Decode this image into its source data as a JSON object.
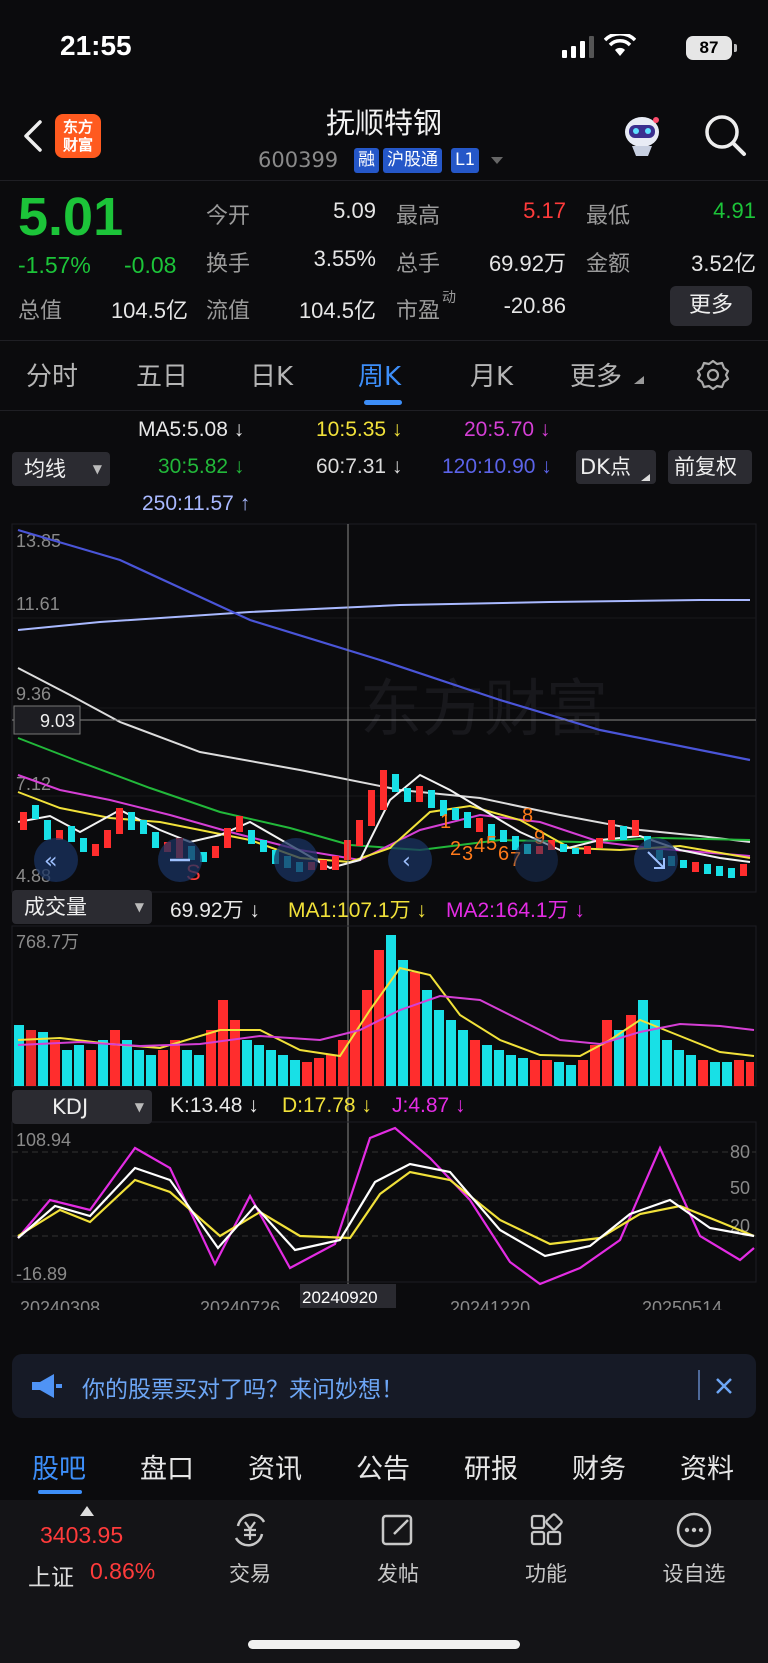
{
  "status": {
    "time": "21:55",
    "battery": "87"
  },
  "header": {
    "logo_text_1": "东方",
    "logo_text_2": "财富",
    "stock_name": "抚顺特钢",
    "stock_code": "600399",
    "tags": [
      "融",
      "沪股通",
      "L1"
    ]
  },
  "quote": {
    "price": "5.01",
    "change_pct": "-1.57%",
    "change_abs": "-0.08",
    "fields": [
      {
        "label": "今开",
        "value": "5.09",
        "color": "#e6e6e6"
      },
      {
        "label": "最高",
        "value": "5.17",
        "color": "#ff3b3b"
      },
      {
        "label": "最低",
        "value": "4.91",
        "color": "#1cc439"
      },
      {
        "label": "换手",
        "value": "3.55%",
        "color": "#e6e6e6"
      },
      {
        "label": "总手",
        "value": "69.92万",
        "color": "#e6e6e6"
      },
      {
        "label": "金额",
        "value": "3.52亿",
        "color": "#e6e6e6"
      },
      {
        "label": "总值",
        "value": "104.5亿",
        "color": "#e6e6e6"
      },
      {
        "label": "流值",
        "value": "104.5亿",
        "color": "#e6e6e6"
      },
      {
        "label": "市盈",
        "label_sup": "动",
        "value": "-20.86",
        "color": "#e6e6e6"
      }
    ],
    "more_label": "更多"
  },
  "period_tabs": [
    "分时",
    "五日",
    "日K",
    "周K",
    "月K",
    "更多"
  ],
  "active_period": "周K",
  "ma_legend": {
    "selector": "均线",
    "items": [
      {
        "text": "MA5:5.08 ↓",
        "color": "#e8e8e8"
      },
      {
        "text": "10:5.35 ↓",
        "color": "#f1e13a"
      },
      {
        "text": "20:5.70 ↓",
        "color": "#d53fd5"
      },
      {
        "text": "30:5.82 ↓",
        "color": "#22b83a"
      },
      {
        "text": "60:7.31 ↓",
        "color": "#dcdcdc"
      },
      {
        "text": "120:10.90 ↓",
        "color": "#5b63e8"
      },
      {
        "text": "250:11.57 ↑",
        "color": "#a9b9ff"
      }
    ],
    "dk_label": "DK点",
    "fq_label": "前复权"
  },
  "price_axis": [
    "13.85",
    "11.61",
    "9.36",
    "7.12",
    "4.88"
  ],
  "crosshair_price": "9.03",
  "markers": {
    "s": "S",
    "numbers": [
      "1",
      "2",
      "3",
      "4",
      "5",
      "6",
      "7",
      "8",
      "9"
    ]
  },
  "volume": {
    "selector": "成交量",
    "value": "69.92万 ↓",
    "ma1": "MA1:107.1万 ↓",
    "ma2": "MA2:164.1万 ↓",
    "axis_top": "768.7万"
  },
  "kdj": {
    "selector": "KDJ",
    "k": "K:13.48 ↓",
    "d": "D:17.78 ↓",
    "j": "J:4.87 ↓",
    "axis_top": "108.94",
    "axis_bottom": "-16.89",
    "levels": [
      "80",
      "50",
      "20"
    ]
  },
  "dates": [
    "20240308",
    "20240726",
    "20240920",
    "20241220",
    "20250514"
  ],
  "banner": {
    "text": "你的股票买对了吗？来问妙想！"
  },
  "section_tabs": [
    "股吧",
    "盘口",
    "资讯",
    "公告",
    "研报",
    "财务",
    "资料"
  ],
  "bottom_bar": {
    "index_value": "3403.95",
    "index_name": "上证",
    "index_change": "0.86%",
    "items": [
      {
        "label": "交易",
        "icon": "trade-yuan-icon"
      },
      {
        "label": "发帖",
        "icon": "compose-icon"
      },
      {
        "label": "功能",
        "icon": "grid-apps-icon"
      },
      {
        "label": "设自选",
        "icon": "more-dots-icon"
      }
    ]
  }
}
